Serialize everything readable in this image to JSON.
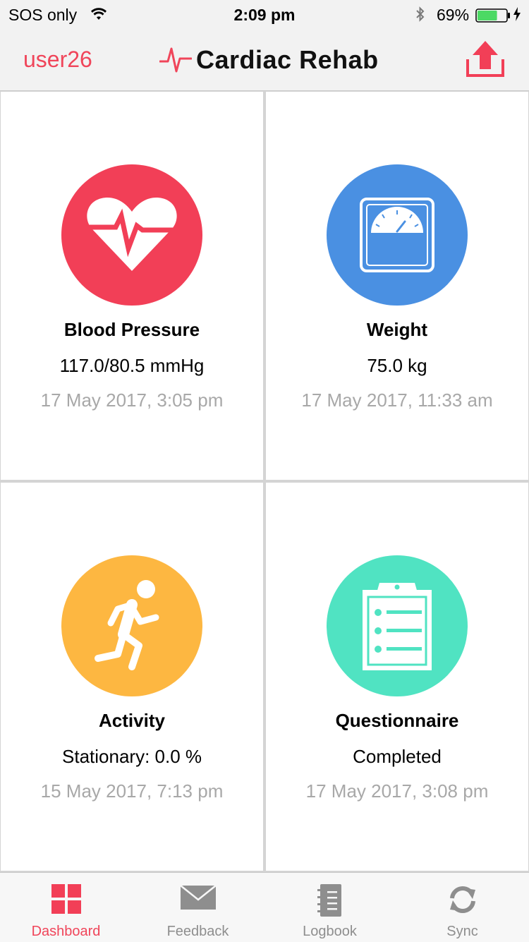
{
  "status_bar": {
    "carrier": "SOS only",
    "time": "2:09 pm",
    "battery_percent": "69%",
    "battery_level": 0.69
  },
  "nav": {
    "user": "user26",
    "title": "Cardiac Rehab",
    "accent_color": "#f0455a"
  },
  "tiles": [
    {
      "name": "Blood Pressure",
      "value": "117.0/80.5 mmHg",
      "date": "17 May 2017, 3:05 pm",
      "icon": "heart-pulse-icon",
      "color": "#f23f57"
    },
    {
      "name": "Weight",
      "value": "75.0 kg",
      "date": "17 May 2017, 11:33 am",
      "icon": "scale-icon",
      "color": "#4a90e2"
    },
    {
      "name": "Activity",
      "value": "Stationary: 0.0 %",
      "date": "15 May 2017, 7:13 pm",
      "icon": "running-person-icon",
      "color": "#fdb741"
    },
    {
      "name": "Questionnaire",
      "value": "Completed",
      "date": "17 May 2017, 3:08 pm",
      "icon": "clipboard-icon",
      "color": "#50e3c2"
    }
  ],
  "tabs": [
    {
      "label": "Dashboard",
      "icon": "grid-icon",
      "active": true
    },
    {
      "label": "Feedback",
      "icon": "envelope-icon",
      "active": false
    },
    {
      "label": "Logbook",
      "icon": "notebook-icon",
      "active": false
    },
    {
      "label": "Sync",
      "icon": "sync-icon",
      "active": false
    }
  ]
}
